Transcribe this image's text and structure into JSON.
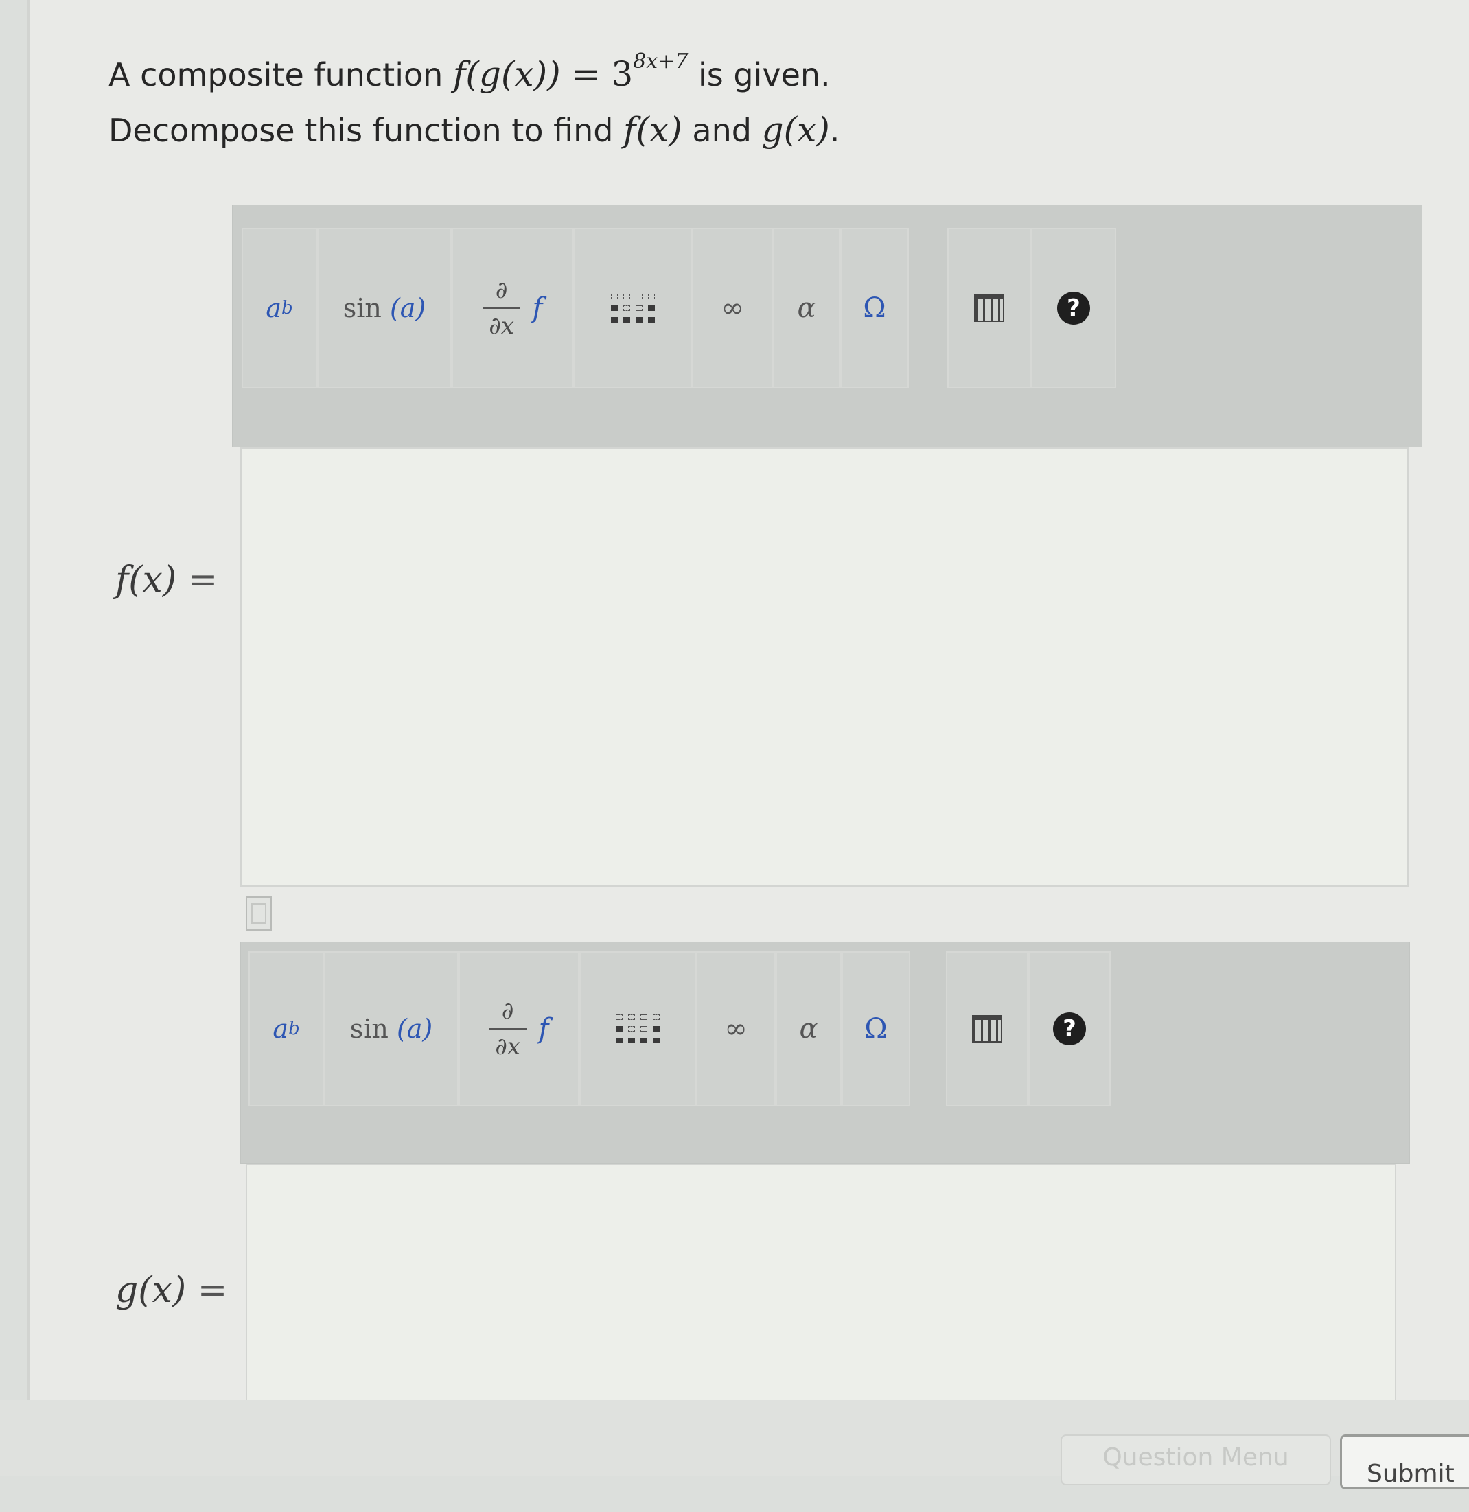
{
  "question": {
    "line1_prefix": "A composite function ",
    "line1_lhs": "f(g(x))",
    "line1_equals": " = 3",
    "line1_exponent": "8x+7",
    "line1_suffix": " is given.",
    "line2_prefix": "Decompose this function to find ",
    "line2_f": "f(x)",
    "line2_and": " and ",
    "line2_g": "g(x)",
    "line2_suffix": "."
  },
  "answers": [
    {
      "label": "f(x)",
      "equals": "=",
      "value": ""
    },
    {
      "label": "g(x)",
      "equals": "=",
      "value": ""
    }
  ],
  "toolbar": {
    "power_base": "a",
    "power_exp": "b",
    "sin_label": "sin",
    "sin_arg": "(a)",
    "deriv_num": "∂",
    "deriv_den": "∂x",
    "deriv_f": "f",
    "infinity": "∞",
    "alpha": "α",
    "omega": "Ω",
    "help": "?"
  },
  "footer": {
    "question_menu_label": "Question Menu",
    "submit_label": "Submit"
  },
  "colors": {
    "accent_blue": "#2d56b3",
    "toolbar_bg": "#c9ccc9",
    "input_bg": "#edefea"
  }
}
